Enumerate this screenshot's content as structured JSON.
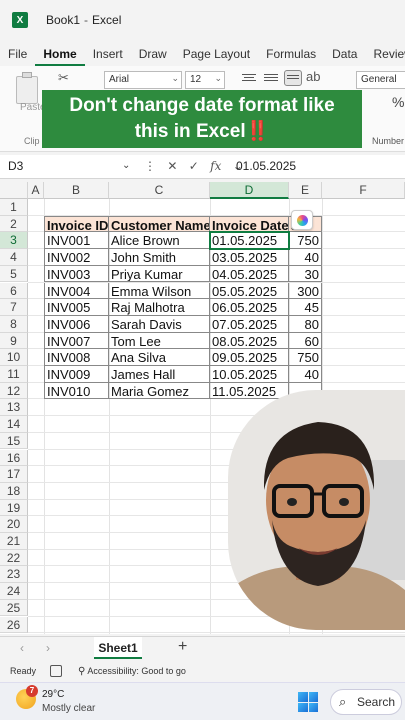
{
  "app": {
    "workbook": "Book1",
    "separator": "-",
    "app_name": "Excel",
    "logo_letter": "X"
  },
  "ribbon_tabs": [
    "File",
    "Home",
    "Insert",
    "Draw",
    "Page Layout",
    "Formulas",
    "Data",
    "Review"
  ],
  "ribbon": {
    "paste_label": "Paste",
    "clipboard_label": "Clip",
    "font_name": "Arial",
    "font_size": "12",
    "number_format": "General",
    "number_group_label": "Number",
    "percent_symbol": "%"
  },
  "caption": {
    "line1": "Don't change date format like",
    "line2": "this in Excel",
    "emphasis": "‼️"
  },
  "formula_bar": {
    "name_box": "D3",
    "fx_label": "fx",
    "value": "01.05.2025"
  },
  "grid": {
    "columns": [
      "A",
      "B",
      "C",
      "D",
      "E",
      "F"
    ],
    "selected_column": "D",
    "selected_row": 3,
    "rows": [
      "1",
      "2",
      "3",
      "4",
      "5",
      "6",
      "7",
      "8",
      "9",
      "10",
      "11",
      "12",
      "13",
      "14",
      "15",
      "16",
      "17",
      "18",
      "19",
      "20",
      "21",
      "22",
      "23",
      "24",
      "25",
      "26"
    ],
    "headers": [
      "Invoice ID",
      "Customer Name",
      "Invoice Date",
      "al"
    ],
    "records": [
      [
        "INV001",
        "Alice Brown",
        "01.05.2025",
        "750"
      ],
      [
        "INV002",
        "John Smith",
        "03.05.2025",
        "40"
      ],
      [
        "INV003",
        "Priya Kumar",
        "04.05.2025",
        "30"
      ],
      [
        "INV004",
        "Emma Wilson",
        "05.05.2025",
        "300"
      ],
      [
        "INV005",
        "Raj Malhotra",
        "06.05.2025",
        "45"
      ],
      [
        "INV006",
        "Sarah Davis",
        "07.05.2025",
        "80"
      ],
      [
        "INV007",
        "Tom Lee",
        "08.05.2025",
        "60"
      ],
      [
        "INV008",
        "Ana Silva",
        "09.05.2025",
        "750"
      ],
      [
        "INV009",
        "James Hall",
        "10.05.2025",
        "40"
      ],
      [
        "INV010",
        "Maria Gomez",
        "11.05.2025",
        ""
      ]
    ]
  },
  "sheets": {
    "active": "Sheet1",
    "add_label": "+"
  },
  "status": {
    "ready": "Ready",
    "accessibility": "Accessibility: Good to go"
  },
  "taskbar": {
    "badge": "7",
    "temperature": "29°C",
    "weather": "Mostly clear",
    "search_label": "Search"
  },
  "colors": {
    "excel_green": "#107c41",
    "caption_green": "#2e8b3e",
    "header_fill": "#fce4d6",
    "selection_fill": "#d3e7d7"
  }
}
